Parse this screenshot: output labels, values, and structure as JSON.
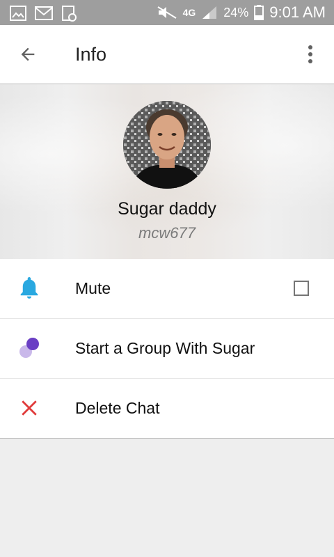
{
  "status_bar": {
    "network_label": "4G",
    "battery_percent": "24%",
    "time": "9:01 AM",
    "icons": [
      "image-icon",
      "mail-icon",
      "sync-icon",
      "mute-icon",
      "lte-icon",
      "signal-icon",
      "battery-icon"
    ]
  },
  "app_bar": {
    "title": "Info",
    "back_icon": "arrow-back-icon",
    "menu_icon": "more-vert-icon"
  },
  "profile": {
    "name": "Sugar daddy",
    "username": "mcw677"
  },
  "actions": [
    {
      "label": "Mute",
      "icon": "bell-icon",
      "checked": false
    },
    {
      "label": "Start a Group With Sugar",
      "icon": "group-icon"
    },
    {
      "label": "Delete Chat",
      "icon": "close-icon"
    }
  ],
  "colors": {
    "status_bar_bg": "#9e9e9e",
    "mute_icon": "#29a8e0",
    "group_icon_primary": "#6a3fc4",
    "group_icon_secondary": "#c9b8ea",
    "delete_icon": "#e03a3a",
    "background": "#eeeeee"
  }
}
